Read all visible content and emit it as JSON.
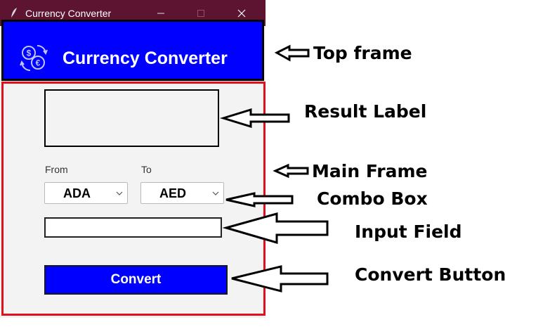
{
  "window": {
    "title": "Currency Converter",
    "colors": {
      "titlebar": "#5d1430",
      "accent": "#0000ff"
    }
  },
  "top_frame": {
    "title": "Currency Converter",
    "icon": "currency-exchange-icon"
  },
  "main_frame": {
    "result_text": "",
    "from_label": "From",
    "to_label": "To",
    "from_currency": "ADA",
    "to_currency": "AED",
    "amount_value": "",
    "convert_label": "Convert"
  },
  "annotations": {
    "top_frame": "Top frame",
    "result_label": "Result Label",
    "main_frame": "Main Frame",
    "combo_box": "Combo Box",
    "input_field": "Input Field",
    "convert_button": "Convert Button"
  }
}
